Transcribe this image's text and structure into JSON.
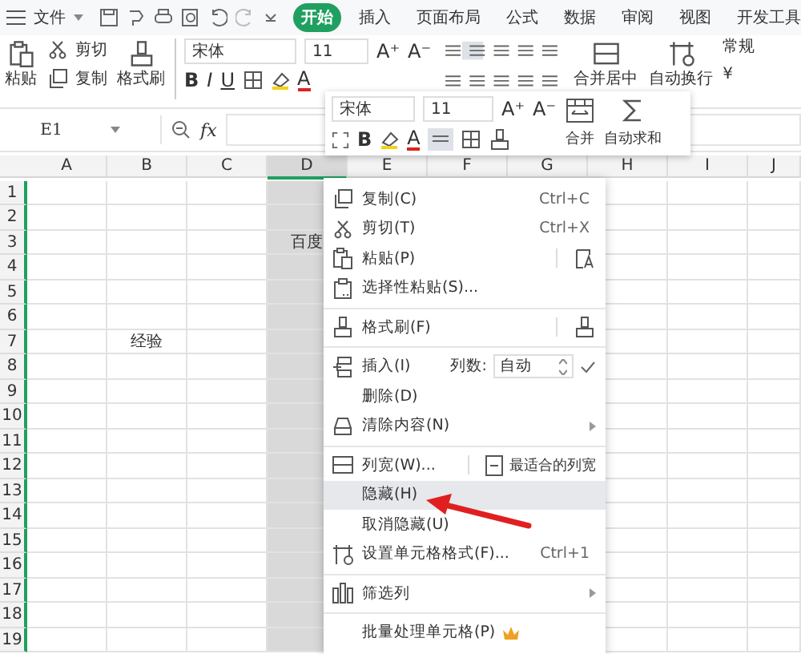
{
  "menu_bar": {
    "file": "文件",
    "tabs": [
      {
        "label": "开始",
        "selected": true
      },
      {
        "label": "插入",
        "selected": false
      },
      {
        "label": "页面布局",
        "selected": false
      },
      {
        "label": "公式",
        "selected": false
      },
      {
        "label": "数据",
        "selected": false
      },
      {
        "label": "审阅",
        "selected": false
      },
      {
        "label": "视图",
        "selected": false
      },
      {
        "label": "开发工具",
        "selected": false
      }
    ]
  },
  "ribbon": {
    "paste": "粘贴",
    "cut": "剪切",
    "copy": "复制",
    "format_painter": "格式刷",
    "font": "宋体",
    "size": "11",
    "size_buttons": [
      "A⁺",
      "A⁻"
    ],
    "style_buttons": [
      "B",
      "I",
      "U"
    ],
    "font_color": "A",
    "merge": "合并居中",
    "wrap": "自动换行",
    "number_format": "常规",
    "currency": "¥"
  },
  "formula_bar": {
    "name_box": "E1",
    "fx": "fx"
  },
  "mini_toolbar": {
    "font": "宋体",
    "size": "11",
    "size_buttons": [
      "A⁺",
      "A⁻"
    ],
    "bold": "B",
    "font_color": "A",
    "merge": "合并",
    "autosum": "自动求和"
  },
  "sheet": {
    "columns": [
      {
        "label": "A",
        "selected": false
      },
      {
        "label": "B",
        "selected": false
      },
      {
        "label": "C",
        "selected": false
      },
      {
        "label": "D",
        "selected": true
      },
      {
        "label": "E",
        "selected": false
      },
      {
        "label": "F",
        "selected": false
      },
      {
        "label": "G",
        "selected": false
      },
      {
        "label": "H",
        "selected": false
      },
      {
        "label": "I",
        "selected": false
      },
      {
        "label": "J",
        "selected": false
      }
    ],
    "rows": [
      {
        "label": "1"
      },
      {
        "label": "2"
      },
      {
        "label": "3",
        "cells": {
          "D": "百度"
        }
      },
      {
        "label": "4"
      },
      {
        "label": "5"
      },
      {
        "label": "6"
      },
      {
        "label": "7",
        "cells": {
          "B": "经验"
        }
      },
      {
        "label": "8"
      },
      {
        "label": "9"
      },
      {
        "label": "10"
      },
      {
        "label": "11"
      },
      {
        "label": "12"
      },
      {
        "label": "13"
      },
      {
        "label": "14"
      },
      {
        "label": "15"
      },
      {
        "label": "16"
      },
      {
        "label": "17"
      },
      {
        "label": "18"
      },
      {
        "label": "19"
      }
    ]
  },
  "context_menu": {
    "items": [
      {
        "kind": "item",
        "label": "复制(C)",
        "shortcut": "Ctrl+C",
        "submenu": false,
        "selected": false
      },
      {
        "kind": "item",
        "label": "剪切(T)",
        "shortcut": "Ctrl+X",
        "submenu": false,
        "selected": false
      },
      {
        "kind": "item",
        "label": "粘贴(P)",
        "submenu": false,
        "selected": false
      },
      {
        "kind": "item",
        "label": "选择性粘贴(S)...",
        "submenu": false,
        "selected": false
      },
      {
        "kind": "separator"
      },
      {
        "kind": "item",
        "label": "格式刷(F)",
        "submenu": false,
        "selected": false
      },
      {
        "kind": "separator"
      },
      {
        "kind": "insert",
        "label": "插入(I)",
        "count_label": "列数:",
        "count_value": "自动",
        "selected": false
      },
      {
        "kind": "item",
        "label": "删除(D)",
        "submenu": false,
        "selected": false
      },
      {
        "kind": "item",
        "label": "清除内容(N)",
        "submenu": true,
        "selected": false
      },
      {
        "kind": "separator"
      },
      {
        "kind": "width",
        "label": "列宽(W)...",
        "side_label": "最适合的列宽",
        "selected": false
      },
      {
        "kind": "item",
        "label": "隐藏(H)",
        "submenu": false,
        "selected": true
      },
      {
        "kind": "item",
        "label": "取消隐藏(U)",
        "submenu": false,
        "selected": false
      },
      {
        "kind": "item",
        "label": "设置单元格格式(F)...",
        "shortcut": "Ctrl+1",
        "submenu": false,
        "selected": false
      },
      {
        "kind": "separator"
      },
      {
        "kind": "item",
        "label": "筛选列",
        "submenu": true,
        "selected": false
      },
      {
        "kind": "separator"
      },
      {
        "kind": "item",
        "label": "批量处理单元格(P)",
        "submenu": false,
        "selected": false
      }
    ]
  }
}
